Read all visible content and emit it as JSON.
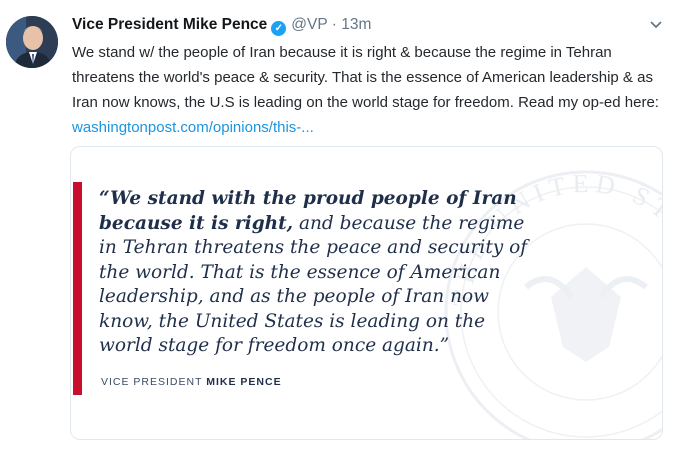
{
  "tweet": {
    "author_name": "Vice President Mike Pence",
    "verified_glyph": "✓",
    "handle": "@VP",
    "separator": "·",
    "time": "13m",
    "text": "We stand w/ the people of Iran because it is right & because the regime in Tehran threatens the world's peace & security. That is the essence of American leadership & as Iran now knows, the U.S is leading on the world stage for freedom. Read my op-ed here: ",
    "link": "washingtonpost.com/opinions/this-...",
    "menu_icon": "chevron-down-icon"
  },
  "card": {
    "quote_bold": "“We stand with the proud people of Iran because it is right,",
    "quote_rest": " and because the regime in Tehran threatens the peace and security of the world. That is the essence of American leadership, and as the people of Iran now know, the United States is leading on the world stage for freedom once again.”",
    "attribution_prefix": "VICE PRESIDENT",
    "attribution_name": "MIKE PENCE",
    "seal_text": "THE UNITED STATES",
    "accent_color": "#c8102e"
  }
}
